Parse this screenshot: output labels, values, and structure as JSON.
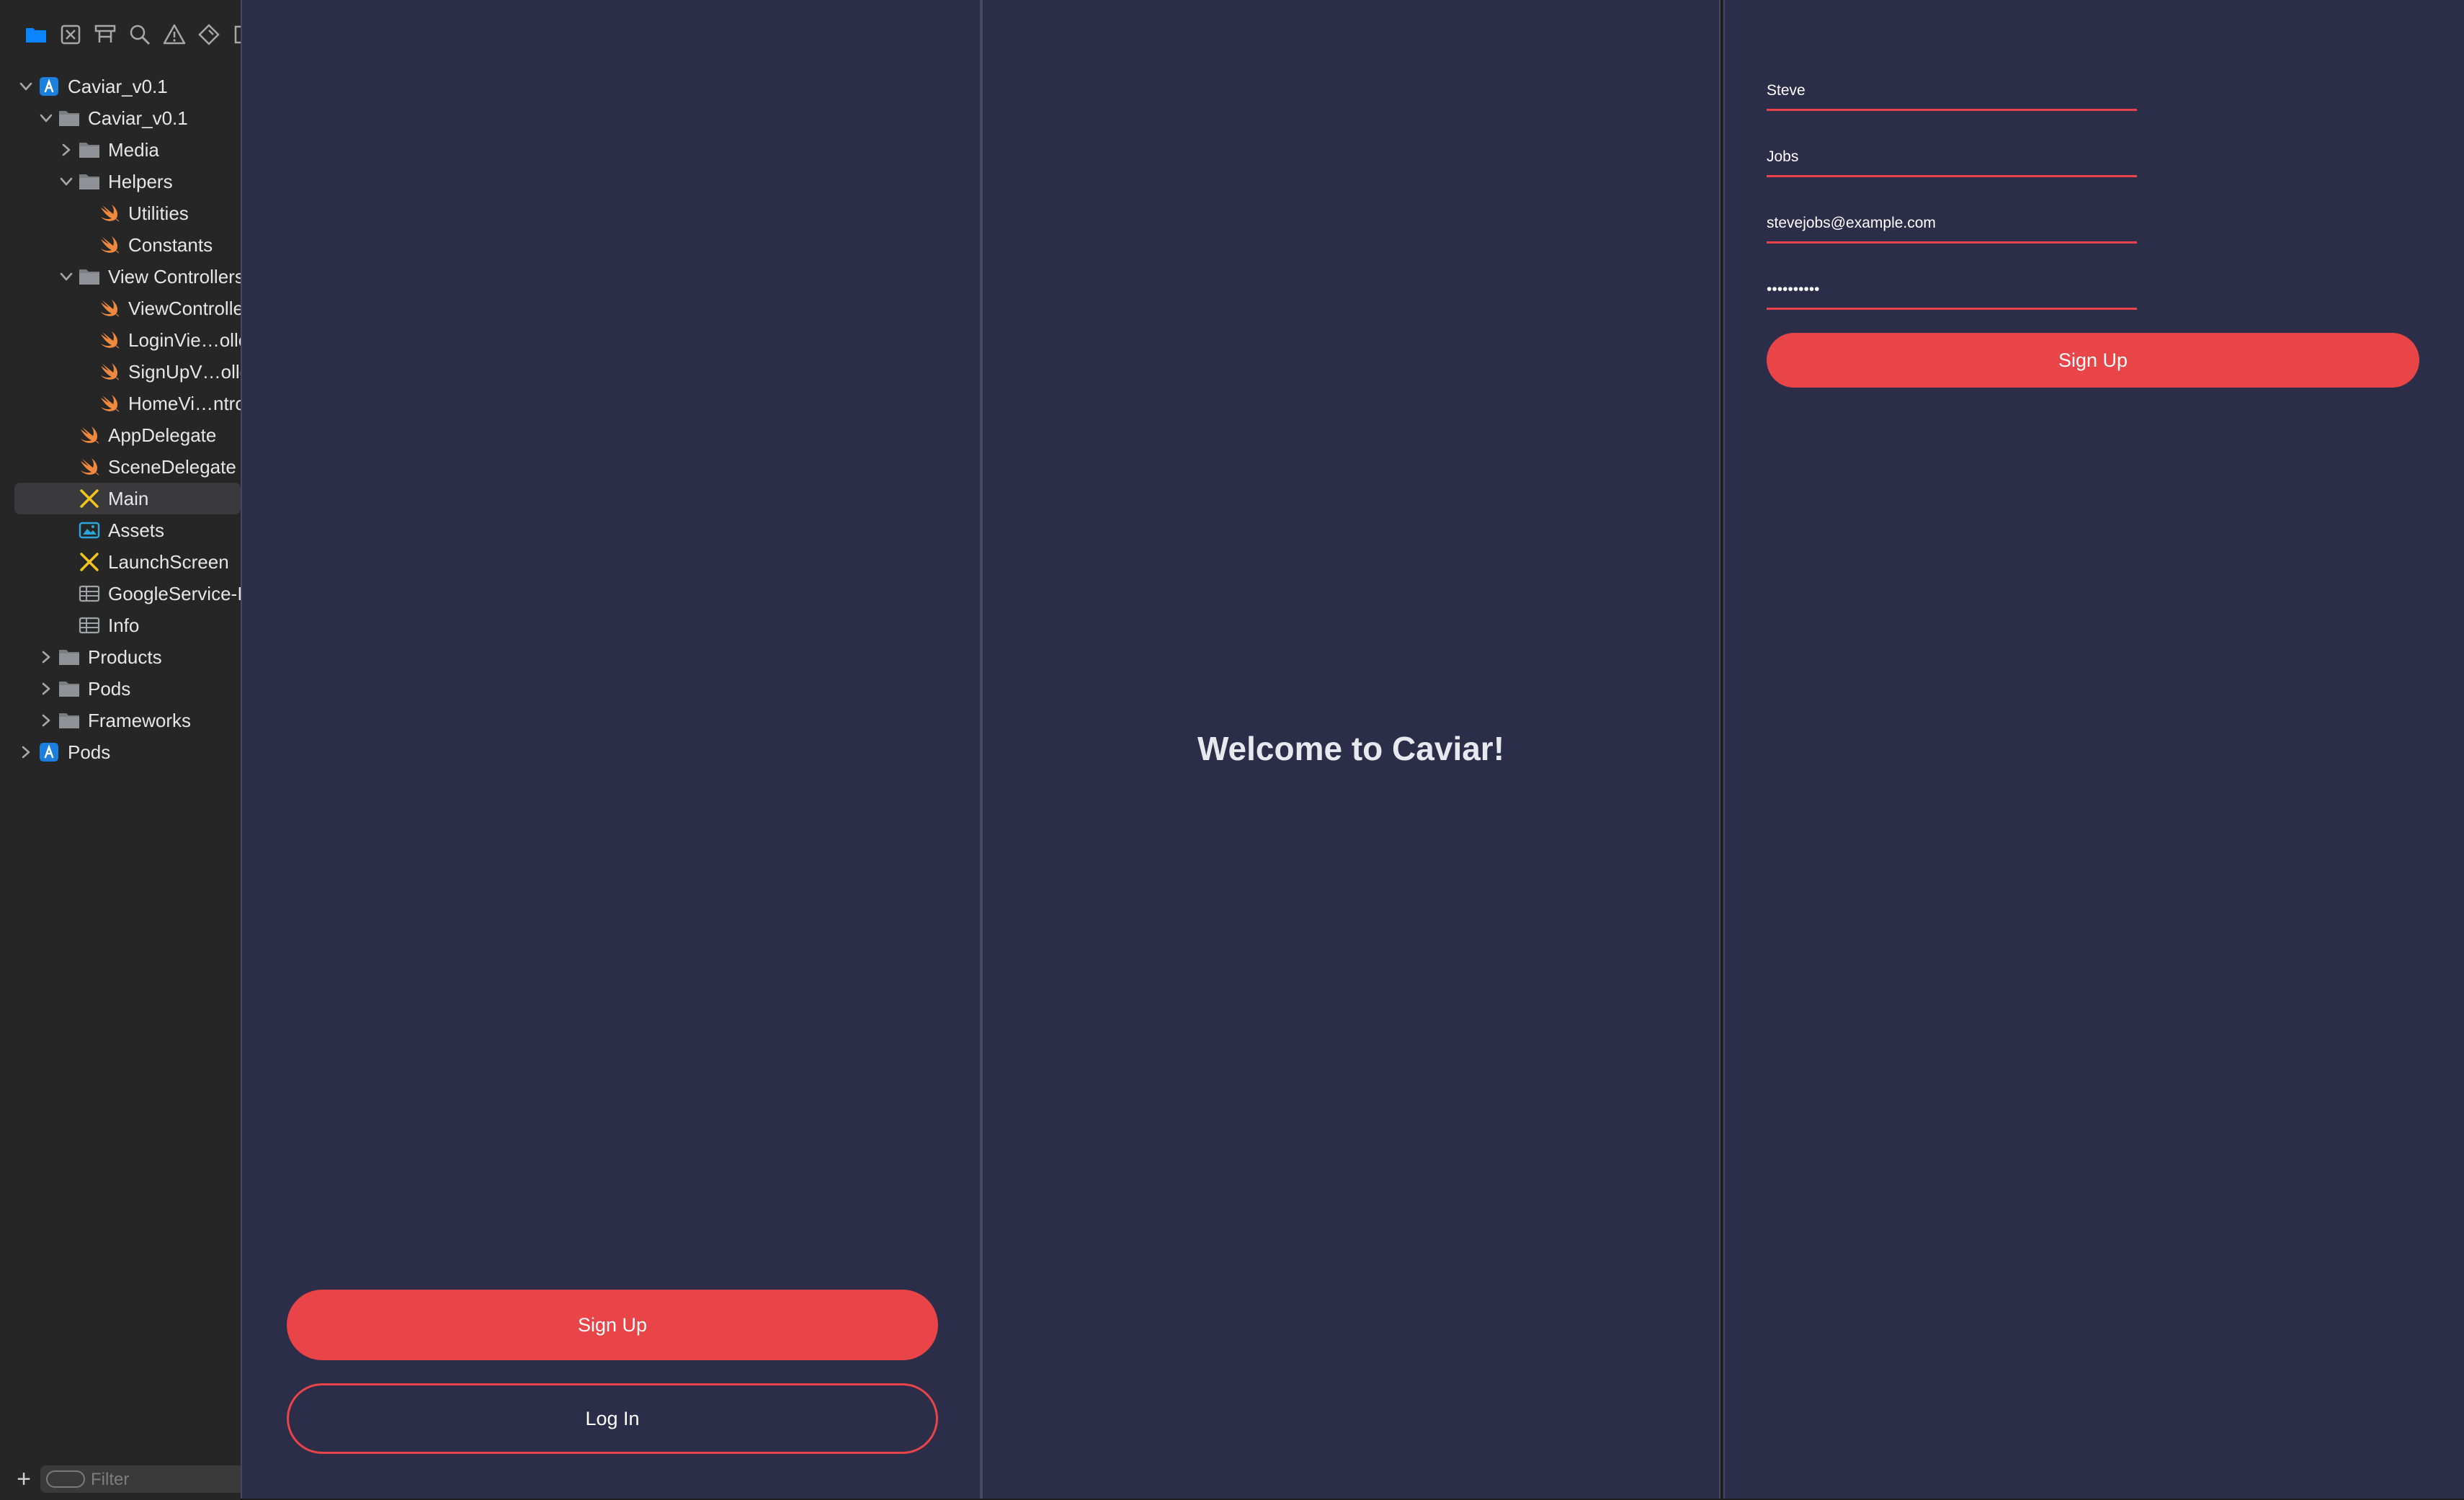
{
  "navigator": {
    "toolbar": [
      {
        "name": "project-navigator-icon",
        "color": "#0a84ff"
      },
      {
        "name": "source-control-icon",
        "color": "#a7a7a7"
      },
      {
        "name": "symbol-navigator-icon",
        "color": "#a7a7a7"
      },
      {
        "name": "find-icon",
        "color": "#a7a7a7"
      },
      {
        "name": "issue-icon",
        "color": "#a7a7a7"
      },
      {
        "name": "test-icon",
        "color": "#a7a7a7"
      },
      {
        "name": "debug-icon",
        "color": "#a7a7a7"
      }
    ],
    "tree": [
      {
        "label": "Caviar_v0.1",
        "icon": "xcode-project-icon",
        "chevron": "down",
        "depth": 0
      },
      {
        "label": "Caviar_v0.1",
        "icon": "folder-icon",
        "chevron": "down",
        "depth": 1
      },
      {
        "label": "Media",
        "icon": "folder-icon",
        "chevron": "right",
        "depth": 2
      },
      {
        "label": "Helpers",
        "icon": "folder-icon",
        "chevron": "down",
        "depth": 2
      },
      {
        "label": "Utilities",
        "icon": "swift-icon",
        "chevron": "",
        "depth": 3
      },
      {
        "label": "Constants",
        "icon": "swift-icon",
        "chevron": "",
        "depth": 3
      },
      {
        "label": "View Controllers",
        "icon": "folder-icon",
        "chevron": "down",
        "depth": 2
      },
      {
        "label": "ViewController",
        "icon": "swift-icon",
        "chevron": "",
        "depth": 3
      },
      {
        "label": "LoginVie…oller",
        "icon": "swift-icon",
        "chevron": "",
        "depth": 3
      },
      {
        "label": "SignUpV…oller",
        "icon": "swift-icon",
        "chevron": "",
        "depth": 3
      },
      {
        "label": "HomeVi…ntroller",
        "icon": "swift-icon",
        "chevron": "",
        "depth": 3
      },
      {
        "label": "AppDelegate",
        "icon": "swift-icon",
        "chevron": "",
        "depth": 2
      },
      {
        "label": "SceneDelegate",
        "icon": "swift-icon",
        "chevron": "",
        "depth": 2
      },
      {
        "label": "Main",
        "icon": "storyboard-icon",
        "chevron": "",
        "depth": 2,
        "selected": true
      },
      {
        "label": "Assets",
        "icon": "asset-catalog-icon",
        "chevron": "",
        "depth": 2
      },
      {
        "label": "LaunchScreen",
        "icon": "storyboard-icon",
        "chevron": "",
        "depth": 2
      },
      {
        "label": "GoogleService-Info",
        "icon": "plist-icon",
        "chevron": "",
        "depth": 2
      },
      {
        "label": "Info",
        "icon": "plist-icon",
        "chevron": "",
        "depth": 2
      },
      {
        "label": "Products",
        "icon": "folder-icon",
        "chevron": "right",
        "depth": 1
      },
      {
        "label": "Pods",
        "icon": "folder-icon",
        "chevron": "right",
        "depth": 1
      },
      {
        "label": "Frameworks",
        "icon": "folder-icon",
        "chevron": "right",
        "depth": 1
      },
      {
        "label": "Pods",
        "icon": "xcode-project-icon",
        "chevron": "right",
        "depth": 0
      }
    ],
    "filter": {
      "placeholder": "Filter",
      "value": ""
    }
  },
  "screens": {
    "landing": {
      "signup_label": "Sign Up",
      "login_label": "Log In"
    },
    "home": {
      "welcome_text": "Welcome to Caviar!"
    },
    "signup": {
      "first_name": "Steve",
      "last_name": "Jobs",
      "email": "stevejobs@example.com",
      "password": "••••••••••",
      "submit_label": "Sign Up"
    }
  },
  "colors": {
    "accent": "#e94447",
    "screen_bg": "#2c2d49",
    "sidebar_bg": "#262626",
    "selection": "#3a3a3c",
    "swift_orange": "#f0883e",
    "storyboard_yellow": "#f5c518",
    "project_blue": "#1b7fe0"
  }
}
